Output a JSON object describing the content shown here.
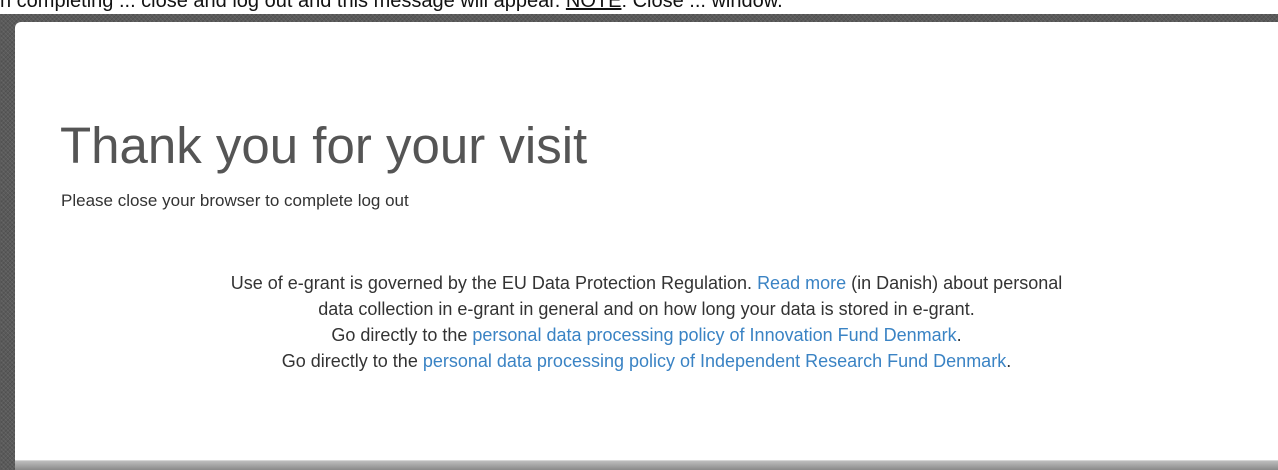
{
  "document_strip": {
    "text_before": "n completing ... close and log out and this message will appear. ",
    "underlined": "NOTE",
    "text_after": ": Close ... window."
  },
  "logout_page": {
    "title": "Thank you for your visit",
    "close_note": "Please close your browser to complete log out"
  },
  "data_protection": {
    "line1_before": "Use of e-grant is governed by the EU Data Protection Regulation. ",
    "read_more_link": "Read more",
    "line1_after": " (in Danish) about personal",
    "line2": "data collection in e-grant in general and on how long your data is stored in e-grant.",
    "line3_before": "Go directly to the ",
    "ifd_link": "personal data processing policy of Innovation Fund Denmark",
    "line3_after": ".",
    "line4_before": "Go directly to the ",
    "dff_link": "personal data processing policy of Independent Research Fund Denmark",
    "line4_after": "."
  },
  "colors": {
    "link": "#3a83c4",
    "title": "#555555",
    "body_text": "#333333",
    "frame": "#5a5a5a"
  }
}
